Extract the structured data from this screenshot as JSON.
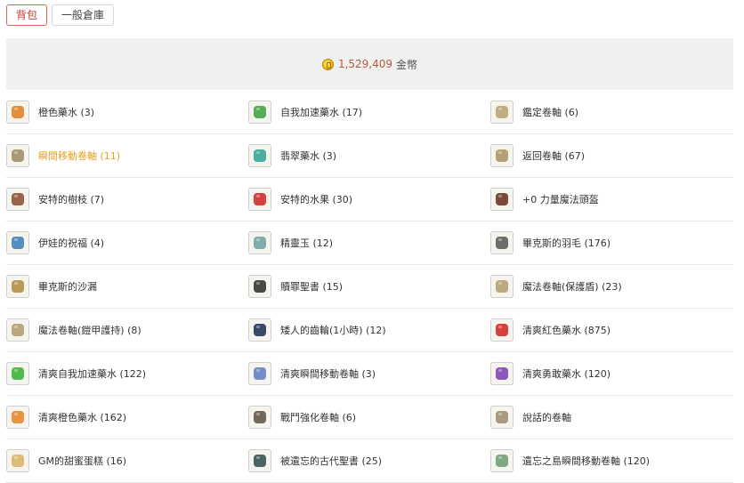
{
  "tabs": [
    {
      "label": "背包",
      "active": true
    },
    {
      "label": "一般倉庫",
      "active": false
    }
  ],
  "gold": {
    "amount": "1,529,409",
    "unit": "金幣"
  },
  "items": [
    {
      "label": "橙色藥水 (3)",
      "icon": "orange-potion-icon",
      "color": "#e07a20"
    },
    {
      "label": "自我加速藥水 (17)",
      "icon": "green-potion-icon",
      "color": "#3aa03a"
    },
    {
      "label": "鑑定卷軸 (6)",
      "icon": "identify-scroll-icon",
      "color": "#b8a070"
    },
    {
      "label": "瞬間移動卷軸 (11)",
      "icon": "teleport-scroll-icon",
      "color": "#9a8a60",
      "highlight": true
    },
    {
      "label": "翡翠藥水 (3)",
      "icon": "emerald-potion-icon",
      "color": "#2aa090"
    },
    {
      "label": "返回卷軸 (67)",
      "icon": "return-scroll-icon",
      "color": "#a89060"
    },
    {
      "label": "安特的樹枝 (7)",
      "icon": "branch-icon",
      "color": "#8a4a2a"
    },
    {
      "label": "安特的水果 (30)",
      "icon": "apple-icon",
      "color": "#d02020"
    },
    {
      "label": "+0 力量魔法頭盔",
      "icon": "helmet-icon",
      "color": "#6a2a1a"
    },
    {
      "label": "伊娃的祝福 (4)",
      "icon": "blessing-vial-icon",
      "color": "#3a7ab8"
    },
    {
      "label": "精靈玉 (12)",
      "icon": "spirit-gem-icon",
      "color": "#6aa0a0"
    },
    {
      "label": "畢克斯的羽毛 (176)",
      "icon": "feather-wreath-icon",
      "color": "#555555"
    },
    {
      "label": "畢克斯的沙漏",
      "icon": "hourglass-icon",
      "color": "#b08a3a"
    },
    {
      "label": "贖罪聖書 (15)",
      "icon": "dark-book-icon",
      "color": "#2a2a2a"
    },
    {
      "label": "魔法卷軸(保護盾) (23)",
      "icon": "shield-scroll-icon",
      "color": "#b09a6a"
    },
    {
      "label": "魔法卷軸(鎧甲護持) (8)",
      "icon": "armor-scroll-icon",
      "color": "#b09a6a"
    },
    {
      "label": "矮人的齒輪(1小時) (12)",
      "icon": "gear-icon",
      "color": "#1a2a50"
    },
    {
      "label": "清爽紅色藥水 (875)",
      "icon": "red-potion-icon",
      "color": "#d02020"
    },
    {
      "label": "清爽自我加速藥水 (122)",
      "icon": "green-bottle-icon",
      "color": "#30b030"
    },
    {
      "label": "清爽瞬間移動卷軸 (3)",
      "icon": "blue-scroll-icon",
      "color": "#5a7ac0"
    },
    {
      "label": "清爽勇敢藥水 (120)",
      "icon": "purple-potion-icon",
      "color": "#7a3ab0"
    },
    {
      "label": "清爽橙色藥水 (162)",
      "icon": "orange-bottle-icon",
      "color": "#e88020"
    },
    {
      "label": "戰鬥強化卷軸 (6)",
      "icon": "combat-scroll-icon",
      "color": "#5a5040"
    },
    {
      "label": "說話的卷軸",
      "icon": "talking-scroll-icon",
      "color": "#9a8a6a"
    },
    {
      "label": "GM的甜蜜蛋糕 (16)",
      "icon": "cake-icon",
      "color": "#d8b060"
    },
    {
      "label": "被遺忘的古代聖書 (25)",
      "icon": "ancient-book-icon",
      "color": "#2a4a4a"
    },
    {
      "label": "遺忘之島瞬間移動卷軸 (120)",
      "icon": "island-scroll-icon",
      "color": "#6a9a70"
    }
  ]
}
